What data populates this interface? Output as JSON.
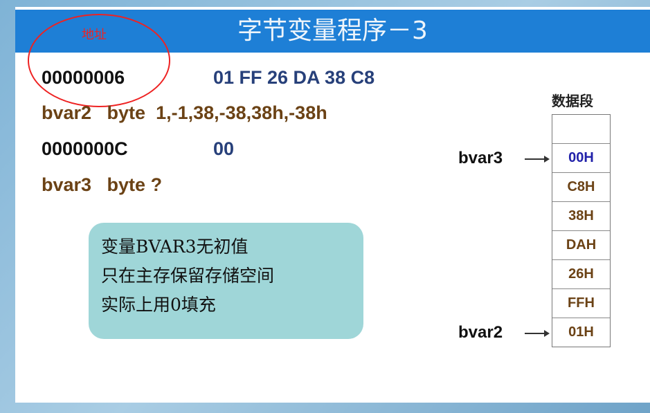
{
  "title": "字节变量程序－3",
  "annotation": "地址",
  "lines": [
    {
      "addr": "00000006",
      "bytes": "01 FF 26 DA 38 C8"
    },
    {
      "code": "bvar2   byte  1,-1,38,-38,38h,-38h"
    },
    {
      "addr": "0000000C",
      "bytes": "00"
    },
    {
      "code": "bvar3   byte ?"
    }
  ],
  "bubble": [
    "变量BVAR3无初值",
    "只在主存保留存储空间",
    "实际上用0填充"
  ],
  "segment": {
    "title": "数据段",
    "cells": [
      "",
      "00H",
      "C8H",
      "38H",
      "DAH",
      "26H",
      "FFH",
      "01H"
    ],
    "pointers": {
      "bvar3": "bvar3",
      "bvar2": "bvar2"
    }
  },
  "colors": {
    "title_bar": "#1e7fd6",
    "code": "#6b4215",
    "bytes": "#27407a",
    "highlight": "#2222aa",
    "bubble": "#9fd6d8",
    "annotation": "#e22222"
  }
}
